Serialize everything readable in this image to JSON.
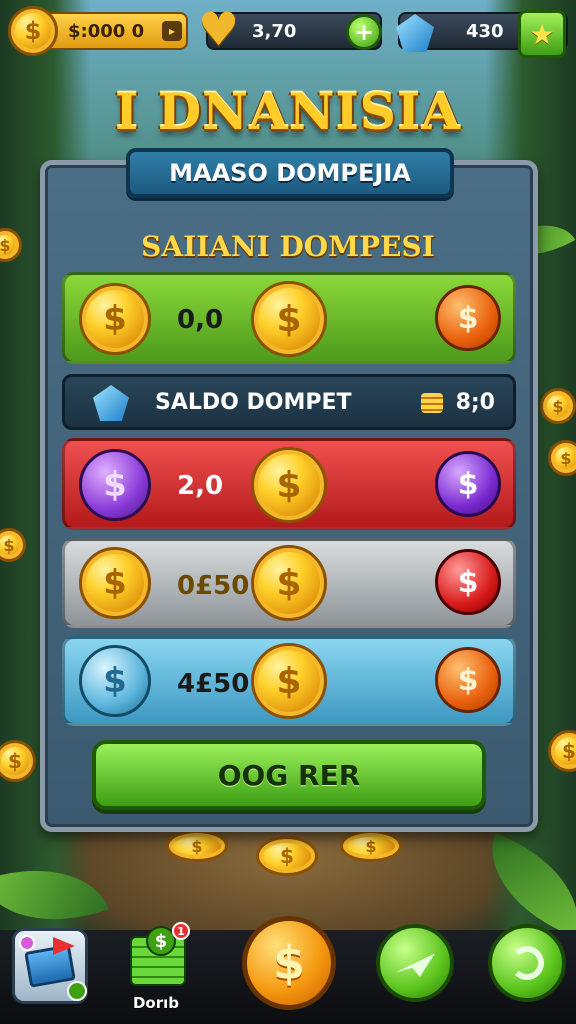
{
  "header": {
    "gold_amount": "$:000 0",
    "hearts_amount": "3,70",
    "gems_amount": "430"
  },
  "title": "I DNANISIA",
  "panel": {
    "ribbon_title": "MAASO DOMPEJIA",
    "subtitle": "SAIIANI DOMPESI",
    "rows": [
      {
        "value": "0,0",
        "color": "#6fc22c"
      },
      {
        "value": "2,0",
        "color": "#d83030"
      },
      {
        "value": "0£50",
        "color": "#b8bcbe"
      },
      {
        "value": "4£50",
        "color": "#5cb4dc"
      }
    ],
    "saldo": {
      "label": "SALDO DOMPET",
      "amount": "8;0"
    },
    "confirm_button": "OOG RER"
  },
  "bottom_nav": {
    "items": [
      {
        "icon": "shop-box-icon"
      },
      {
        "icon": "cash-stack-icon",
        "label": "Dorıb",
        "badge": "1"
      },
      {
        "icon": "dollar-coin-icon"
      },
      {
        "icon": "arrow-icon"
      },
      {
        "icon": "undo-icon"
      }
    ]
  },
  "badges": {
    "dollar": "$",
    "plus": "+",
    "star": "★",
    "heart": "♥"
  }
}
